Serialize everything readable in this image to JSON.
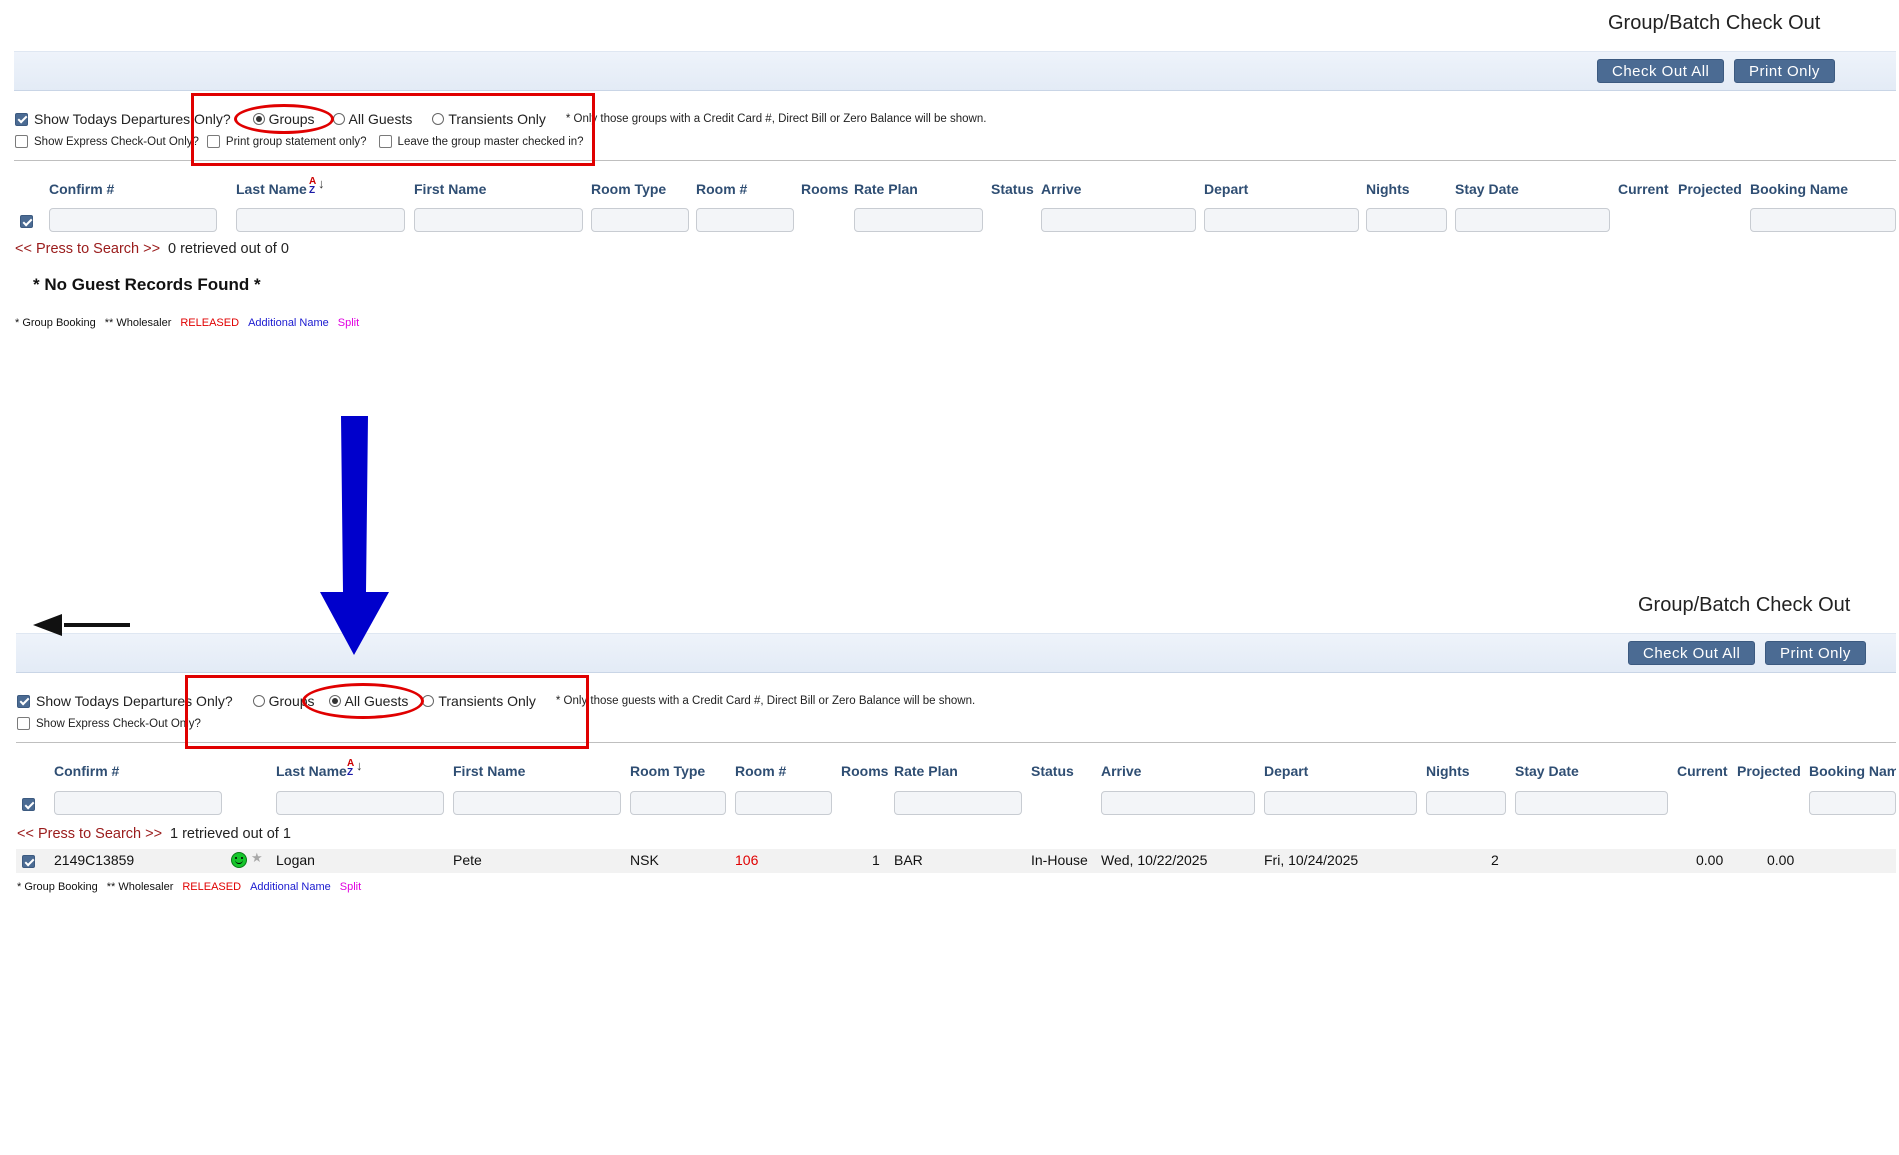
{
  "page_title": "Group/Batch Check Out",
  "toolbar": {
    "check_out_all": "Check Out All",
    "print_only": "Print Only"
  },
  "options": {
    "show_todays_departures": "Show Todays Departures Only?",
    "radio_groups": "Groups",
    "radio_all_guests": "All Guests",
    "radio_transients": "Transients Only",
    "show_express": "Show Express Check-Out Only?",
    "print_group_statement": "Print group statement only?",
    "leave_group_master": "Leave the group master checked in?",
    "note_groups": "* Only those groups with a Credit Card #, Direct Bill or Zero Balance will be shown.",
    "note_guests": "* Only those guests with a Credit Card #, Direct Bill or Zero Balance will be shown."
  },
  "columns": {
    "confirm": "Confirm #",
    "last_name": "Last Name",
    "first_name": "First Name",
    "room_type": "Room Type",
    "room_no": "Room #",
    "rooms": "Rooms",
    "rate_plan": "Rate Plan",
    "status": "Status",
    "arrive": "Arrive",
    "depart": "Depart",
    "nights": "Nights",
    "stay_date": "Stay Date",
    "current": "Current",
    "projected": "Projected",
    "booking_name": "Booking Name",
    "booking_name_cut": "Booking Name"
  },
  "search": {
    "link": "<< Press to Search >>"
  },
  "top_panel": {
    "retrieved": "0 retrieved out of 0",
    "no_records": "* No Guest Records Found *"
  },
  "bottom_panel": {
    "retrieved": "1 retrieved out of 1",
    "row": {
      "confirm": "2149C13859",
      "last_name": "Logan",
      "first_name": "Pete",
      "room_type": "NSK",
      "room_no": "106",
      "rooms": "1",
      "rate_plan": "BAR",
      "status": "In-House",
      "arrive": "Wed, 10/22/2025",
      "depart": "Fri, 10/24/2025",
      "nights": "2",
      "current": "0.00",
      "projected": "0.00"
    }
  },
  "legend": {
    "group_booking": "* Group Booking",
    "wholesaler": "** Wholesaler",
    "released": "RELEASED",
    "additional_name": "Additional Name",
    "split": "Split"
  },
  "icons": {
    "sort": "sort-az-icon",
    "guest_status": "smiley-icon",
    "star": "star-icon"
  },
  "colors": {
    "button": "#4b6b93",
    "header_text": "#2f4e73",
    "highlight": "#e00000",
    "arrow": "#0000cc"
  }
}
